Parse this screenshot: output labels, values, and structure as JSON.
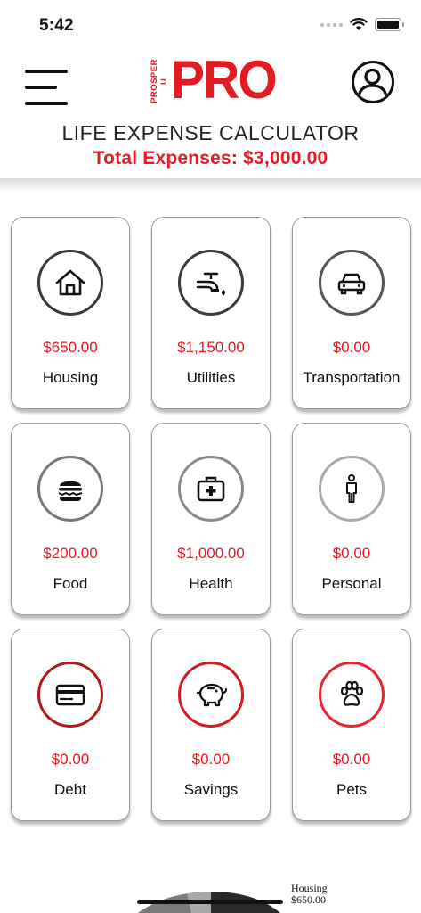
{
  "status_bar": {
    "time": "5:42"
  },
  "header": {
    "logo_small": "PROSPER U",
    "logo_big": "PRO"
  },
  "title": "LIFE EXPENSE CALCULATOR",
  "total": "Total Expenses: $3,000.00",
  "categories": [
    {
      "label": "Housing",
      "amount": "$650.00",
      "icon": "house-icon",
      "ring": "#3a3a3a"
    },
    {
      "label": "Utilities",
      "amount": "$1,150.00",
      "icon": "faucet-icon",
      "ring": "#3a3a3a"
    },
    {
      "label": "Transportation",
      "amount": "$0.00",
      "icon": "car-icon",
      "ring": "#555555"
    },
    {
      "label": "Food",
      "amount": "$200.00",
      "icon": "burger-icon",
      "ring": "#777777"
    },
    {
      "label": "Health",
      "amount": "$1,000.00",
      "icon": "medical-kit-icon",
      "ring": "#8a8a8a"
    },
    {
      "label": "Personal",
      "amount": "$0.00",
      "icon": "person-icon",
      "ring": "#aaaaaa"
    },
    {
      "label": "Debt",
      "amount": "$0.00",
      "icon": "credit-card-icon",
      "ring": "#b01a1f"
    },
    {
      "label": "Savings",
      "amount": "$0.00",
      "icon": "piggy-bank-icon",
      "ring": "#d11c22"
    },
    {
      "label": "Pets",
      "amount": "$0.00",
      "icon": "paw-icon",
      "ring": "#e8242b"
    }
  ],
  "chart_tooltip": {
    "label": "Housing",
    "value": "$650.00"
  },
  "colors": {
    "accent": "#e31b23"
  }
}
